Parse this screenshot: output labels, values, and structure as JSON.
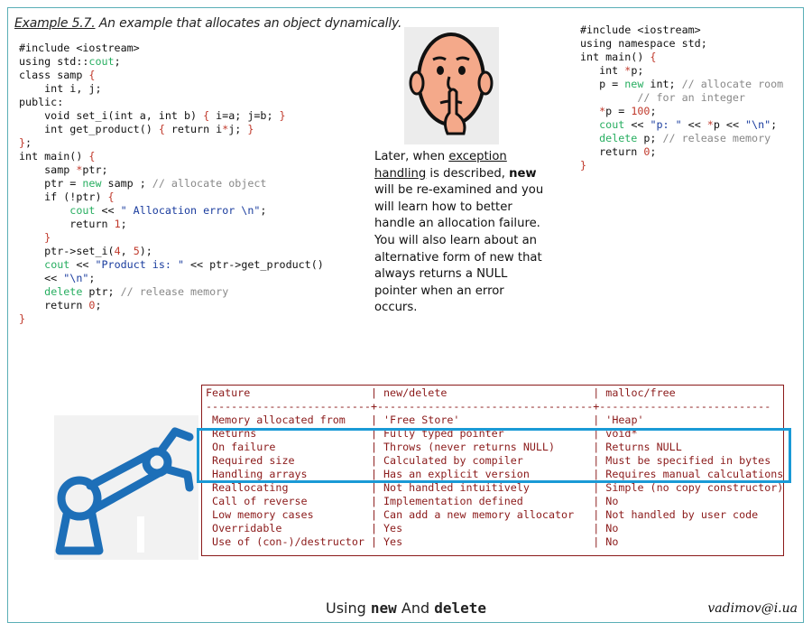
{
  "caption": {
    "example": "Example 5.7.",
    "text": " An example that allocates an object dynamically."
  },
  "left_code": [
    "#include <iostream>",
    "using std::cout;",
    "class samp {",
    "    int i, j;",
    "public:",
    "    void set_i(int a, int b) { i=a; j=b; }",
    "    int get_product() { return i*j; }",
    "};",
    "int main() {",
    "    samp *ptr;",
    "    ptr = new samp ; // allocate object",
    "    if (!ptr) {",
    "        cout << \" Allocation error \\n\";",
    "        return 1;",
    "    }",
    "    ptr->set_i(4, 5);",
    "    cout << \"Product is: \" << ptr->get_product()",
    "    << \"\\n\";",
    "    delete ptr; // release memory",
    "    return 0;",
    "}"
  ],
  "right_code": [
    "#include <iostream>",
    "using namespace std;",
    "int main() {",
    "   int *p;",
    "   p = new int; // allocate room",
    "         // for an integer",
    "   *p = 100;",
    "   cout << \"p: \" << *p << \"\\n\";",
    "   delete p; // release memory",
    "   return 0;",
    "}"
  ],
  "note": {
    "p1": "Later, when ",
    "link": "exception handling",
    "p2": " is described, ",
    "bold": "new",
    "p3": " will be re-examined and you will learn how to better handle an allocation failure. You will also learn about an alternative form of new that always returns a NULL pointer when an error occurs."
  },
  "table": {
    "header": "Feature                   | new/delete                       | malloc/free",
    "separator": "--------------------------+----------------------------------+---------------------------",
    "rows": [
      " Memory allocated from    | 'Free Store'                     | 'Heap'",
      " Returns                  | Fully typed pointer              | void*",
      " On failure               | Throws (never returns NULL)      | Returns NULL",
      " Required size            | Calculated by compiler           | Must be specified in bytes",
      " Handling arrays          | Has an explicit version          | Requires manual calculations",
      " Reallocating             | Not handled intuitively          | Simple (no copy constructor)",
      " Call of reverse          | Implementation defined           | No",
      " Low memory cases         | Can add a new memory allocator   | Not handled by user code",
      " Overridable              | Yes                              | No",
      " Use of (con-)/destructor | Yes                              | No"
    ]
  },
  "footer": {
    "pre": "Using ",
    "new": "new",
    "mid": " And ",
    "delete": "delete"
  },
  "author": "vadimov@i.ua",
  "colors": {
    "frame": "#5aaeb6",
    "highlight": "#1a9ad6",
    "table": "#8b1a1a",
    "robot": "#1d6fb8"
  }
}
